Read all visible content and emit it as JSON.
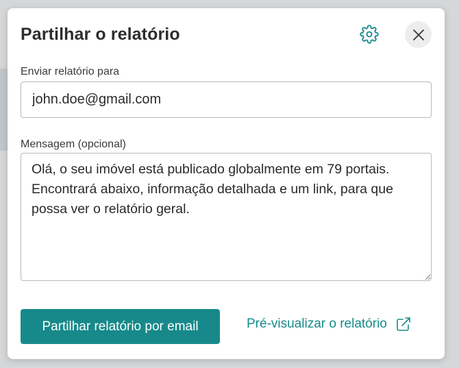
{
  "dialog": {
    "title": "Partilhar o relatório",
    "settings_icon": "gear-icon",
    "close_icon": "close-icon"
  },
  "recipient": {
    "label": "Enviar relatório para",
    "value": "john.doe@gmail.com"
  },
  "message": {
    "label": "Mensagem (opcional)",
    "value": "Olá, o seu imóvel está publicado globalmente em 79 portais. Encontrará abaixo, informação detalhada e um link, para que possa ver o relatório geral."
  },
  "actions": {
    "share_button_label": "Partilhar relatório por email",
    "preview_link_label": "Pré-visualizar o relatório",
    "preview_icon": "external-link-icon"
  },
  "colors": {
    "accent": "#17898a",
    "text": "#2d2d2d",
    "border": "#b9b9b9"
  }
}
